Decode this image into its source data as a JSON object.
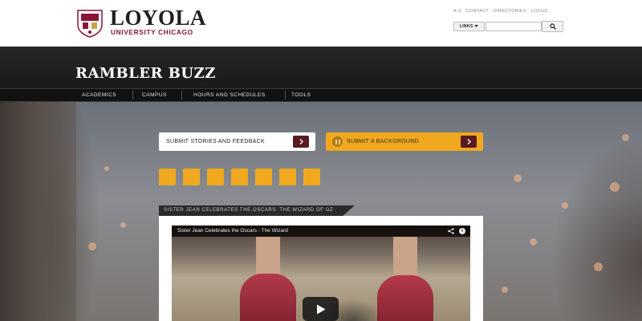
{
  "header": {
    "logo_name": "LOYOLA",
    "logo_sub": "UNIVERSITY CHICAGO",
    "util_links": [
      "A-Z",
      "CONTACT",
      "DIRECTORIES",
      "LOCUS"
    ],
    "links_button": "LINKS",
    "search_placeholder": ""
  },
  "site_title": "RAMBLER BUZZ",
  "nav": {
    "items": [
      "ACADEMICS",
      "CAMPUS",
      "HOURS AND SCHEDULES",
      "TOOLS"
    ]
  },
  "actions": {
    "submit_stories": "SUBMIT STORIES AND FEEDBACK",
    "submit_background": "SUBMIT A BACKGROUND"
  },
  "carousel": {
    "count": 7
  },
  "video": {
    "tab_title": "SISTER JEAN CELEBRATES THE OSCARS: THE WIZARD OF OZ",
    "player_title": "Sister Jean Celebrates the Oscars - The Wizard"
  },
  "colors": {
    "gold": "#f0a81e",
    "maroon": "#5a1a22",
    "brand": "#8a1538"
  },
  "icons": [
    "seal-logo-icon",
    "chevron-down-icon",
    "search-icon",
    "arrow-right-icon",
    "pause-icon",
    "share-icon",
    "info-icon",
    "play-icon"
  ]
}
